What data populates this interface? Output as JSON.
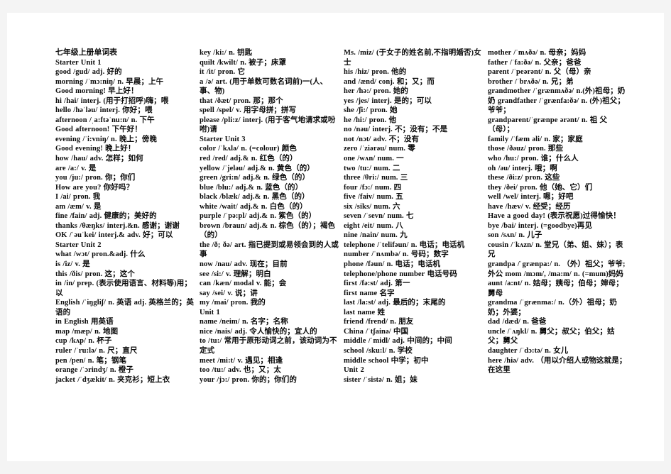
{
  "document": {
    "title": "七年级上册单词表",
    "page_background": "#f4f4f4",
    "paper_background": "#ffffff",
    "text_color": "#0b0b0b"
  },
  "columns": [
    {
      "id": "column-1",
      "entries": [
        "七年级上册单词表",
        "Starter Unit 1",
        "good /gud/ adj.  好的",
        "morning /ˈmɔ:niŋ/ n.  早晨；上午",
        "Good morning!  早上好！",
        "hi /hai/ interj. (用于打招呼)嗨；喂",
        "hello /həˈləu/ interj.  你好；喂",
        "afternoon /ˌa:ftəˈnu:n/ n.  下午",
        "Good afternoon!  下午好！",
        "evening /ˈi:vniŋ/ n.  晚上；傍晚",
        "Good evening!  晚上好！",
        "how /hau/ adv.  怎样；如何",
        "are /a:/ v.  是",
        "you /ju:/ pron.  你；你们",
        "How are you?  你好吗？",
        "I /ai/ pron.  我",
        "am /æm/ v.  是",
        "fine /fain/ adj.  健康的；美好的",
        "thanks /θæŋks/ interj.&n.  感谢；谢谢",
        "OK /ˈəuˈkei/ interj.& adv.  好；可以",
        "Starter Unit 2",
        "what /wɔt/ pron.&adj.  什么",
        "is /iz/ v.  是",
        "this /ðis/ pron.  这；这个",
        "in /in/ prep. (表示使用语言、材料等)用；以",
        "English /ˈiŋgliʃ/ n.  英语 adj.  英格兰的；英语的",
        "in English  用英语",
        "map /mæp/ n.  地图",
        "cup /kʌp/ n.  杯子",
        "ruler /ˈru:lə/ n.  尺；直尺",
        "pen /pen/ n.  笔；钢笔",
        "orange /ˈɔrindʒ/ n.  橙子",
        "jacket /ˈdʒækit/ n.  夹克衫；短上衣"
      ]
    },
    {
      "id": "column-2",
      "entries": [
        "key /ki:/ n.  钥匙",
        "quilt /kwilt/ n.  被子；床罩",
        "it /it/ pron.  它",
        "a /ə/  art. (用于单数可数名词前)一(人、事、物)",
        "that /ðæt/ pron.  那；那个",
        "spell /spel/ v.  用字母拼；拼写",
        "please /pli:z/  interj. (用于客气地请求或吩咐)请",
        "Starter Unit 3",
        "color /ˈkʌlə/ n. (=colour)  颜色",
        "red /red/ adj.& n.  红色（的）",
        "yellow /ˈjeləu/ adj.& n.  黄色（的）",
        "green /gri:n/ adj.& n.  绿色（的）",
        "blue /blu:/ adj.& n.  蓝色（的）",
        "black /blæk/ adj.& n.  黑色（的）",
        "white /wait/ adj.& n.  白色（的）",
        "purple /ˈpə:pl/ adj.& n.  紫色（的）",
        "brown /braun/ adj.& n.  棕色（的）；褐色（的）",
        "the /ð; ðə/ art.  指已提到或易领会到的人或事",
        "now /nau/ adv.  现在；目前",
        "see /si:/ v.  理解；明白",
        "can /kæn/ modal v.  能；会",
        "say /sei/ v.  说；讲",
        "my /mai/ pron.  我的",
        "Unit 1",
        "name /neim/ n.  名字；名称",
        "nice /nais/ adj.  令人愉快的；宜人的",
        "to /tu:/  常用于原形动词之前，该动词为不定式",
        "meet /mi:t/ v.  遇见；相逢",
        "too /tu:/ adv.  也；又；太",
        "your /jɔ:/ pron.  你的；你们的"
      ]
    },
    {
      "id": "column-3",
      "entries": [
        "Ms. /miz/ (于女子的姓名前,不指明婚否)女士",
        "his /hiz/ pron.  他的",
        "and /ænd/ conj.  和；又；而",
        "her /hə:/ pron.  她的",
        "yes /jes/ interj.  是的；可以",
        "she /ʃi:/ pron.  她",
        "he /hi:/ pron.  他",
        "no /nəu/ interj.  不；没有；不是",
        "not /nɔt/ adv.  不；没有",
        "zero /ˈziərəu/ num.  零",
        "one /wʌn/ num.  一",
        "two /tu:/ num.  二",
        "three /θri:/ num.  三",
        "four /fɔ:/ num.  四",
        "five /faiv/ num.  五",
        "six /siks/ num.  六",
        "seven /ˈsevn/ num.  七",
        "eight /eit/ num.  八",
        "nine /nain/ num.  九",
        "telephone /ˈtelifəun/ n.  电话；电话机",
        "number /ˈnʌmbə/ n.  号码；数字",
        "phone /fəun/ n.  电话；电话机",
        "telephone/phone number  电话号码",
        "first /fə:st/ adj.  第一",
        "first name  名字",
        "last /la:st/ adj.  最后的；末尾的",
        "last name  姓",
        "friend /frend/ n.  朋友",
        "China /ˈtʃainə/  中国",
        "middle /ˈmidl/ adj.  中间的；中间",
        "school /sku:l/ n.  学校",
        "middle school  中学；初中",
        "Unit 2",
        "sister /ˈsistə/ n.  姐；妹"
      ]
    },
    {
      "id": "column-4",
      "entries": [
        "mother /ˈmʌðə/ n.  母亲；妈妈",
        "father /ˈfa:ðə/ n.  父亲；爸爸",
        "parent /ˈpeərənt/ n.  父（母）亲",
        "brother /ˈbrʌðə/ n.  兄；弟",
        "grandmother /ˈgrænmʌðə/ n.(外)祖母；奶奶 grandfather /ˈgrænfa:ðə/ n. (外)祖父；爷爷；",
        "grandparent/ˈgrænpe ərənt/    n.  祖 父（母）；",
        "family /ˈfæm əli/ n.  家；家庭",
        "those /ðəuz/ pron.  那些",
        "who /hu:/ pron.  谁；什么人",
        "oh /əu/ interj.  哦；啊",
        "these /ði:z/ pron.  这些",
        "they /ðei/ pron.  他（她、它）们",
        "well /wel/ interj.  嗯；好吧",
        "have /hæv/ v.  经受；经历",
        "Have a good day! (表示祝愿)过得愉快！",
        "bye /bai/ interj. (=goodbye)再见",
        "son /sʌn/ n.  儿子",
        "cousin /ˈkʌzn/ n.  堂兄（弟、姐、妹）；表兄",
        "grandpa /ˈgrænpa:/  n.  （外）祖父；爷爷;外公 mom /mɔm/, /ma:m/ n. (=mum)妈妈",
        "aunt /a:nt/ n.  姑母；姨母；伯母；婶母；舅母",
        "grandma /ˈgrænma:/  n.（外）祖母；奶奶；外婆；",
        "dad /dæd/ n.  爸爸",
        "uncle /ˈʌŋkl/  n.  舅父；叔父；伯父；姑父；舅父",
        "daughter /ˈdɔ:tə/ n.  女儿",
        "here /hiə/  adv. （用以介绍人或物这就是；在这里"
      ]
    }
  ]
}
